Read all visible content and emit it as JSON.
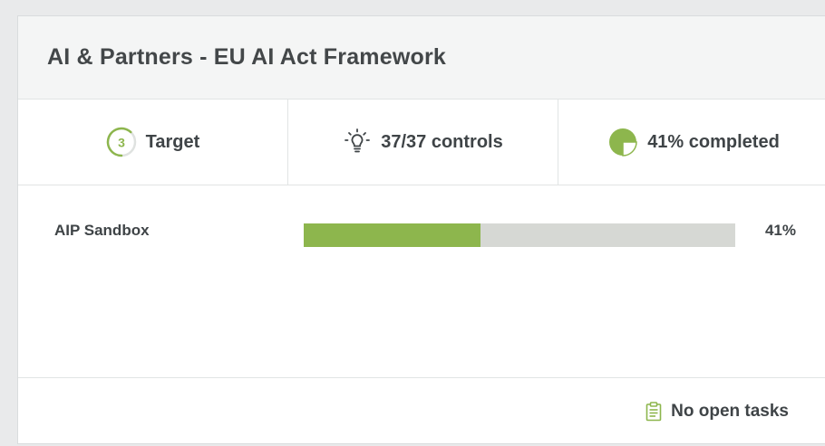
{
  "card": {
    "title": "AI & Partners - EU AI Act Framework"
  },
  "stats": {
    "target": {
      "number": "3",
      "label": "Target",
      "icon": "target-ring-icon"
    },
    "controls": {
      "label": "37/37 controls",
      "icon": "lightbulb-icon"
    },
    "completed": {
      "label": "41% completed",
      "icon": "pie-chart-icon",
      "fraction": 0.41
    }
  },
  "rows": [
    {
      "label": "AIP Sandbox",
      "progress": 0.41,
      "value": "41%"
    }
  ],
  "footer": {
    "tasks_label": "No open tasks",
    "icon": "clipboard-icon"
  },
  "colors": {
    "accent": "#8db64d",
    "track": "#d6d8d4",
    "text": "#3f4447"
  }
}
